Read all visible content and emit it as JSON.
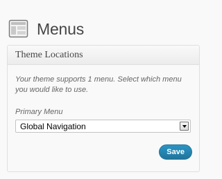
{
  "header": {
    "title": "Menus",
    "icon": "menus-icon"
  },
  "theme_locations": {
    "title": "Theme Locations",
    "description": "Your theme supports 1 menu. Select which menu you would like to use.",
    "field_label": "Primary Menu",
    "selected_value": "Global Navigation",
    "save_label": "Save"
  },
  "colors": {
    "accent": "#21759b",
    "text": "#464646"
  }
}
